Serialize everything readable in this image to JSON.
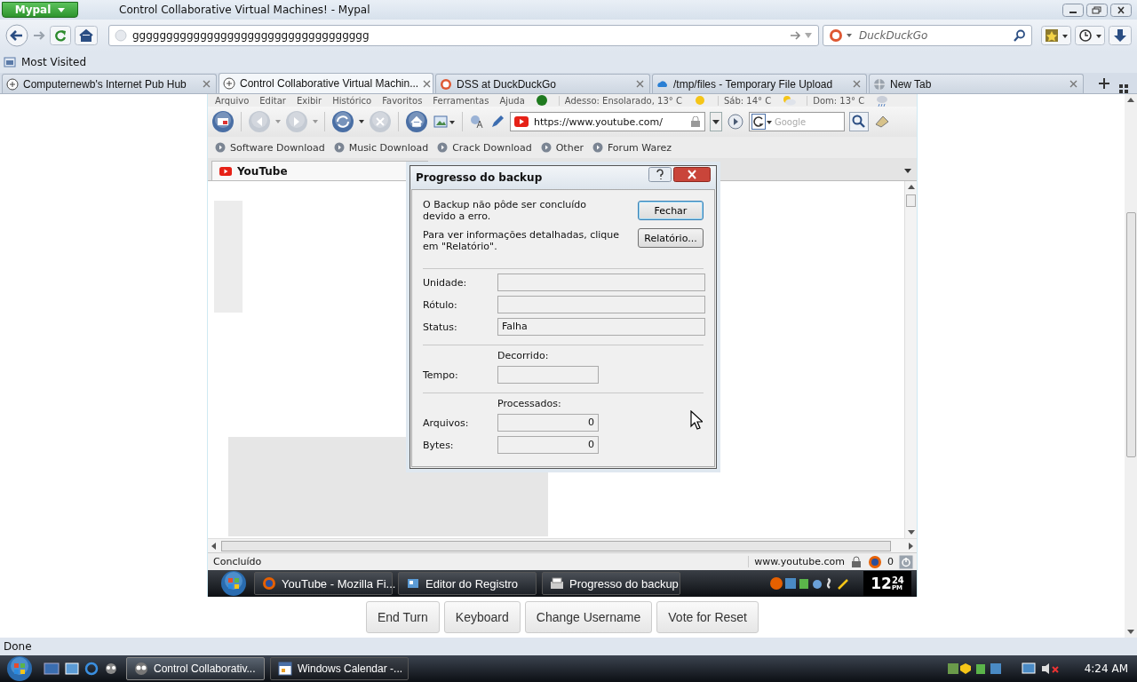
{
  "window": {
    "app_button": "Mypal",
    "title": "Control Collaborative Virtual Machines! - Mypal"
  },
  "navigation": {
    "address": "ggggggggggggggggggggggggggggggggggg",
    "search_placeholder": "DuckDuckGo"
  },
  "bookmarks": [
    "Most Visited"
  ],
  "tabs": [
    {
      "label": "Computernewb's Internet Pub Hub",
      "selected": false
    },
    {
      "label": "Control Collaborative Virtual Machin...",
      "selected": true
    },
    {
      "label": "DSS at DuckDuckGo",
      "selected": false
    },
    {
      "label": "/tmp/files - Temporary File Upload",
      "selected": false
    },
    {
      "label": "New Tab",
      "selected": false
    }
  ],
  "vm": {
    "menu": [
      "Arquivo",
      "Editar",
      "Exibir",
      "Histórico",
      "Favoritos",
      "Ferramentas",
      "Ajuda"
    ],
    "weather": [
      "Adesso: Ensolarado, 13° C",
      "Sáb: 14° C",
      "Dom: 13° C"
    ],
    "address": "https://www.youtube.com/",
    "search_placeholder": "Google",
    "links": [
      "Software Download",
      "Music Download",
      "Crack Download",
      "Other",
      "Forum Warez"
    ],
    "tab": "YouTube",
    "status": "Concluído",
    "status_url": "www.youtube.com",
    "status_count": "0",
    "taskbar": [
      "YouTube - Mozilla Fi...",
      "Editor do Registro",
      "Progresso do backup"
    ],
    "clock": {
      "hour": "12",
      "minutes": "24",
      "period": "PM"
    },
    "dialog": {
      "title": "Progresso do backup",
      "message": "O Backup não pôde ser concluído devido a erro.",
      "hint": "Para ver informações detalhadas, clique em \"Relatório\".",
      "buttons": [
        {
          "label": "Fechar",
          "default": true
        },
        {
          "label": "Relatório...",
          "default": false
        }
      ],
      "sections": [
        {
          "kind": "wide",
          "rows": [
            {
              "label": "Unidade:"
            },
            {
              "label": "Rótulo:"
            },
            {
              "label": "Status:",
              "value": "Falha"
            }
          ]
        },
        {
          "kind": "narrow",
          "heading": "Decorrido:",
          "rows": [
            {
              "label": "Tempo:"
            }
          ]
        },
        {
          "kind": "narrow",
          "heading": "Processados:",
          "rows": [
            {
              "label": "Arquivos:",
              "value": "0"
            },
            {
              "label": "Bytes:",
              "value": "0"
            }
          ]
        }
      ]
    }
  },
  "actions": [
    "End Turn",
    "Keyboard",
    "Change Username",
    "Vote for Reset"
  ],
  "status_bar": "Done",
  "taskbar": {
    "items": [
      {
        "label": "Control Collaborativ...",
        "selected": true
      },
      {
        "label": "Windows Calendar -...",
        "selected": false
      }
    ],
    "clock": "4:24 AM"
  }
}
